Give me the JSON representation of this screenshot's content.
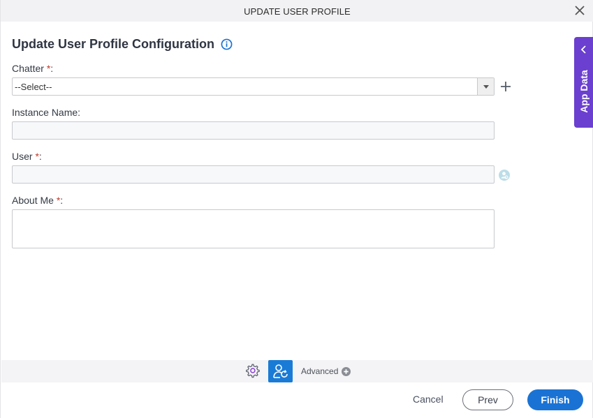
{
  "window": {
    "title": "UPDATE USER PROFILE"
  },
  "form": {
    "heading": "Update User Profile Configuration",
    "fields": {
      "chatter": {
        "label": "Chatter",
        "required_mark": "*",
        "suffix": ":",
        "value": "--Select--"
      },
      "instance_name": {
        "label": "Instance Name:",
        "value": ""
      },
      "user": {
        "label": "User",
        "required_mark": "*",
        "suffix": ":",
        "value": ""
      },
      "about_me": {
        "label": "About Me",
        "required_mark": "*",
        "suffix": ":",
        "value": ""
      }
    }
  },
  "side_panel": {
    "label": "App Data"
  },
  "toolbar": {
    "advanced_label": "Advanced"
  },
  "footer": {
    "cancel_label": "Cancel",
    "prev_label": "Prev",
    "finish_label": "Finish"
  },
  "colors": {
    "accent": "#1a73d4",
    "app_data": "#6b3fcf",
    "required": "#c0392b"
  }
}
